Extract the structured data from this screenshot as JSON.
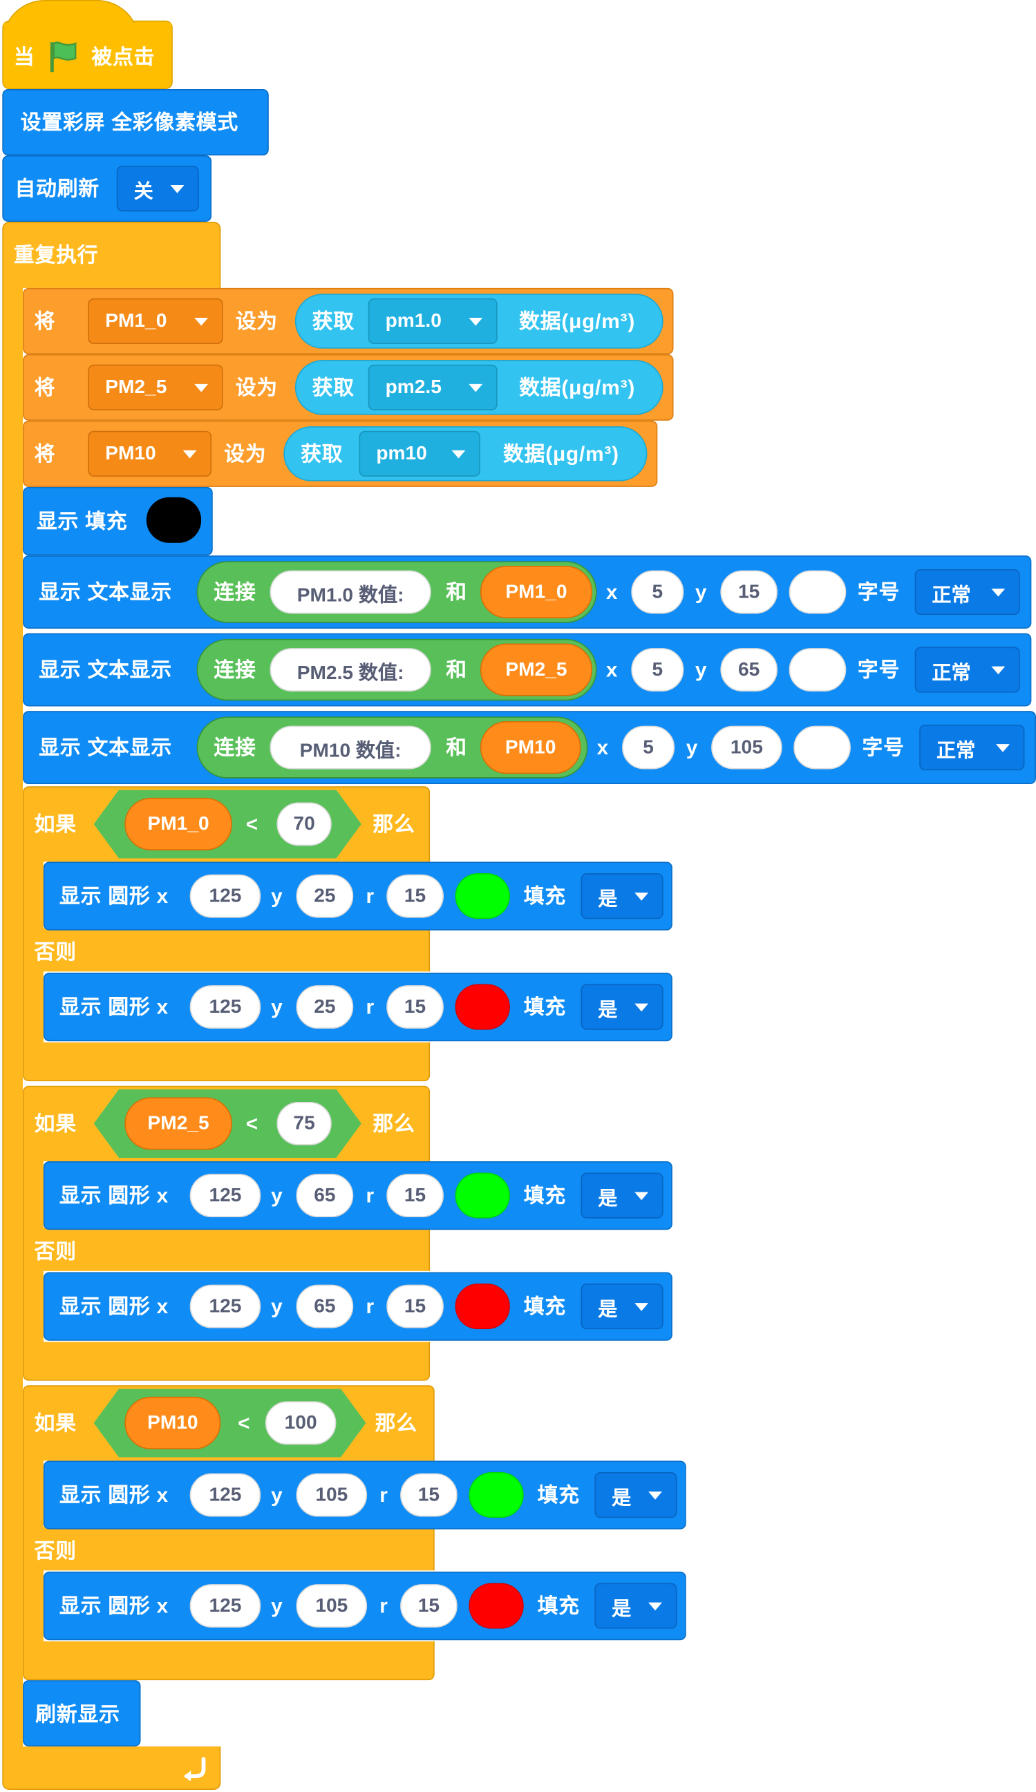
{
  "colors": {
    "motion_blue": "#0f8cf5",
    "variable_orange": "#fc9d2c",
    "control_yellow": "#ffb91e",
    "event_gold": "#ffbf00",
    "sensor_cyan": "#33c3f0",
    "operator_green": "#59c059",
    "green_dot": "#00ff00",
    "red_dot": "#ff0000",
    "black_dot": "#000000"
  },
  "hat": {
    "prefix": "当",
    "icon": "green-flag-icon",
    "suffix": "被点击"
  },
  "set_mode": "设置彩屏 全彩像素模式",
  "auto_refresh": {
    "label": "自动刷新",
    "value": "关"
  },
  "loop_label": "重复执行",
  "assign": [
    {
      "verb": "将",
      "var": "PM1_0",
      "mid": "设为",
      "get": "获取",
      "sensor": "pm1.0",
      "unit": "数据(μg/m³)"
    },
    {
      "verb": "将",
      "var": "PM2_5",
      "mid": "设为",
      "get": "获取",
      "sensor": "pm2.5",
      "unit": "数据(μg/m³)"
    },
    {
      "verb": "将",
      "var": "PM10",
      "mid": "设为",
      "get": "获取",
      "sensor": "pm10",
      "unit": "数据(μg/m³)"
    }
  ],
  "fill": {
    "label": "显示 填充",
    "color": "#000000"
  },
  "texts": [
    {
      "label": "显示 文本显示",
      "join": "连接",
      "str": "PM1.0 数值:",
      "and": "和",
      "var": "PM1_0",
      "x_label": "x",
      "x": "5",
      "y_label": "y",
      "y": "15",
      "size_label": "字号",
      "size": "正常"
    },
    {
      "label": "显示 文本显示",
      "join": "连接",
      "str": "PM2.5 数值:",
      "and": "和",
      "var": "PM2_5",
      "x_label": "x",
      "x": "5",
      "y_label": "y",
      "y": "65",
      "size_label": "字号",
      "size": "正常"
    },
    {
      "label": "显示 文本显示",
      "join": "连接",
      "str": "PM10  数值:",
      "and": "和",
      "var": "PM10",
      "x_label": "x",
      "x": "5",
      "y_label": "y",
      "y": "105",
      "size_label": "字号",
      "size": "正常"
    }
  ],
  "conditions": [
    {
      "if": "如果",
      "var": "PM1_0",
      "op": "<",
      "value": "70",
      "then": "那么",
      "else": "否则",
      "then_circle": {
        "label": "显示 圆形 x",
        "x": "125",
        "y_label": "y",
        "y": "25",
        "r_label": "r",
        "r": "15",
        "color": "#00ff00",
        "fill_label": "填充",
        "fill": "是"
      },
      "else_circle": {
        "label": "显示 圆形 x",
        "x": "125",
        "y_label": "y",
        "y": "25",
        "r_label": "r",
        "r": "15",
        "color": "#ff0000",
        "fill_label": "填充",
        "fill": "是"
      }
    },
    {
      "if": "如果",
      "var": "PM2_5",
      "op": "<",
      "value": "75",
      "then": "那么",
      "else": "否则",
      "then_circle": {
        "label": "显示 圆形 x",
        "x": "125",
        "y_label": "y",
        "y": "65",
        "r_label": "r",
        "r": "15",
        "color": "#00ff00",
        "fill_label": "填充",
        "fill": "是"
      },
      "else_circle": {
        "label": "显示 圆形 x",
        "x": "125",
        "y_label": "y",
        "y": "65",
        "r_label": "r",
        "r": "15",
        "color": "#ff0000",
        "fill_label": "填充",
        "fill": "是"
      }
    },
    {
      "if": "如果",
      "var": "PM10",
      "op": "<",
      "value": "100",
      "then": "那么",
      "else": "否则",
      "then_circle": {
        "label": "显示 圆形 x",
        "x": "125",
        "y_label": "y",
        "y": "105",
        "r_label": "r",
        "r": "15",
        "color": "#00ff00",
        "fill_label": "填充",
        "fill": "是"
      },
      "else_circle": {
        "label": "显示 圆形 x",
        "x": "125",
        "y_label": "y",
        "y": "105",
        "r_label": "r",
        "r": "15",
        "color": "#ff0000",
        "fill_label": "填充",
        "fill": "是"
      }
    }
  ],
  "refresh": "刷新显示",
  "loop_arrow_icon": "loop-arrow-icon"
}
